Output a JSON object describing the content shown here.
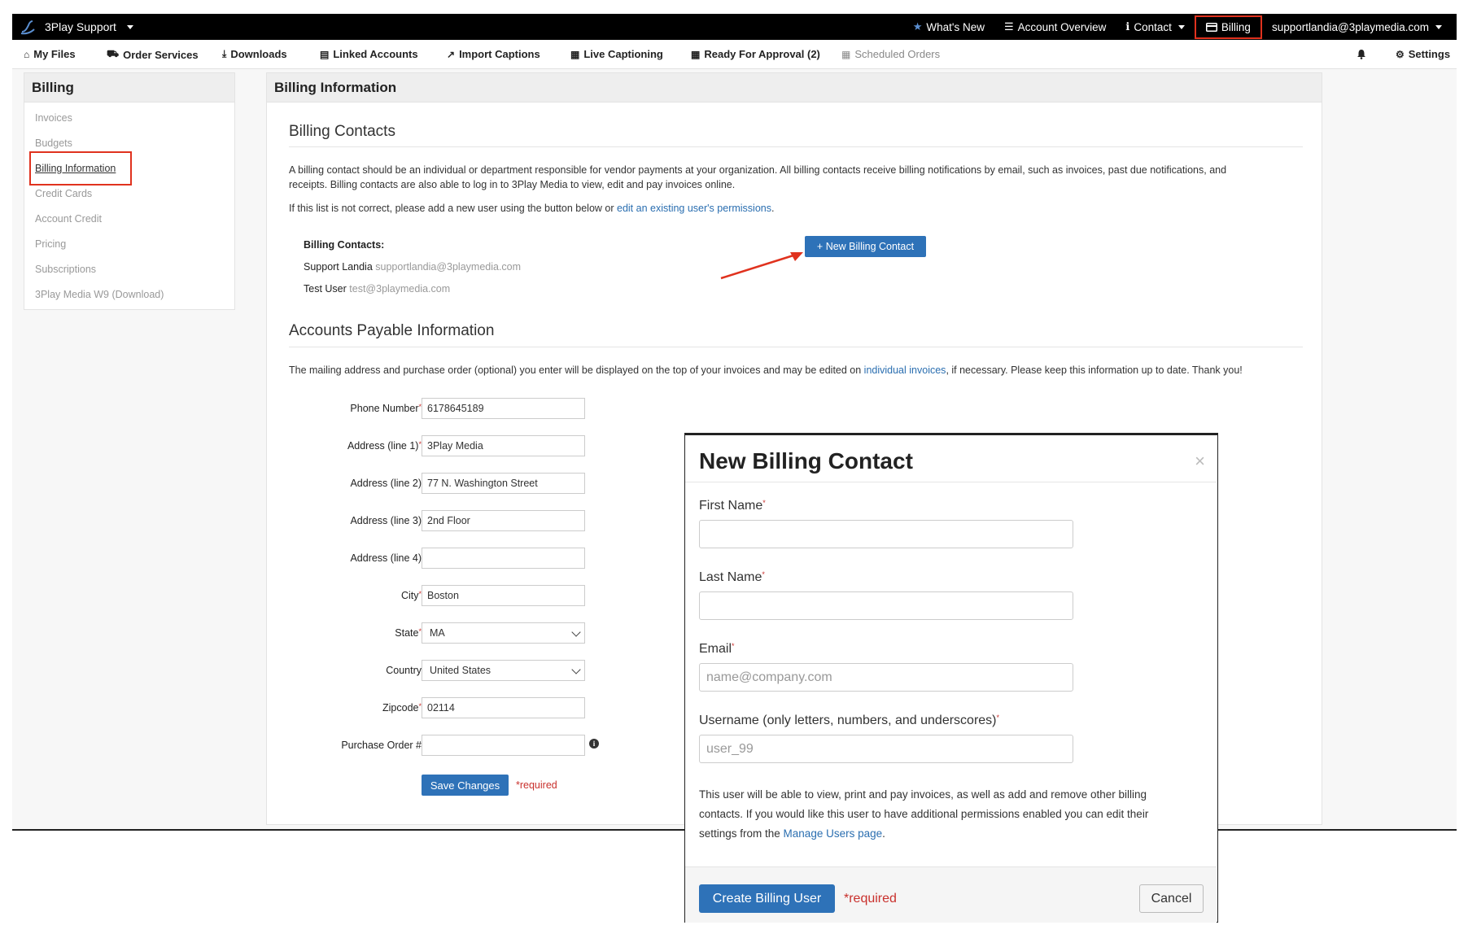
{
  "topbar": {
    "brand": "3Play Support",
    "items": [
      {
        "icon": "star-icon",
        "label": "What's New"
      },
      {
        "icon": "list-icon",
        "label": "Account Overview"
      },
      {
        "icon": "info-circle-icon",
        "label": "Contact"
      },
      {
        "icon": "credit-card-icon",
        "label": "Billing"
      },
      {
        "label": "supportlandia@3playmedia.com"
      }
    ]
  },
  "nav": {
    "items": [
      {
        "icon": "home-icon",
        "label": "My Files"
      },
      {
        "icon": "cart-icon",
        "label": "Order Services"
      },
      {
        "icon": "download-icon",
        "label": "Downloads"
      },
      {
        "icon": "id-card-icon",
        "label": "Linked Accounts"
      },
      {
        "icon": "external-link-icon",
        "label": "Import Captions"
      },
      {
        "icon": "calendar-icon",
        "label": "Live Captioning"
      },
      {
        "icon": "calendar-icon",
        "label": "Ready For Approval (2)"
      },
      {
        "icon": "calendar-icon",
        "label": "Scheduled Orders"
      }
    ],
    "settings": "Settings"
  },
  "sidebar": {
    "title": "Billing",
    "items": [
      "Invoices",
      "Budgets",
      "Billing Information",
      "Credit Cards",
      "Account Credit",
      "Pricing",
      "Subscriptions",
      "3Play Media W9 (Download)"
    ],
    "active_index": 2
  },
  "content": {
    "header": "Billing Information",
    "billing_contacts": {
      "title": "Billing Contacts",
      "description_1": "A billing contact should be an individual or department responsible for vendor payments at your organization. All billing contacts receive billing notifications by email, such as invoices, past due notifications, and",
      "description_2": "receipts. Billing contacts are also able to log in to 3Play Media to view, edit and pay invoices online.",
      "instruction_prefix": "If this list is not correct, please add a new user using the button below or ",
      "instruction_link": "edit an existing user's permissions",
      "instruction_suffix": ".",
      "list_label": "Billing Contacts:",
      "contacts": [
        {
          "name": "Support Landia",
          "email": "supportlandia@3playmedia.com"
        },
        {
          "name": "Test User",
          "email": "test@3playmedia.com"
        }
      ],
      "new_button": "+ New Billing Contact"
    },
    "accounts_payable": {
      "title": "Accounts Payable Information",
      "description_prefix": "The mailing address and purchase order (optional) you enter will be displayed on the top of your invoices and may be edited on ",
      "description_link": "individual invoices",
      "description_suffix": ", if necessary. Please keep this information up to date. Thank you!",
      "fields": [
        {
          "label": "Phone Number",
          "required": true,
          "value": "6178645189"
        },
        {
          "label": "Address (line 1)",
          "required": true,
          "value": "3Play Media"
        },
        {
          "label": "Address (line 2)",
          "required": false,
          "value": "77 N. Washington Street"
        },
        {
          "label": "Address (line 3)",
          "required": false,
          "value": "2nd Floor"
        },
        {
          "label": "Address (line 4)",
          "required": false,
          "value": ""
        },
        {
          "label": "City",
          "required": true,
          "value": "Boston"
        },
        {
          "label": "State",
          "required": true,
          "value": "MA",
          "type": "select"
        },
        {
          "label": "Country",
          "required": false,
          "value": "United States",
          "type": "select"
        },
        {
          "label": "Zipcode",
          "required": true,
          "value": "02114"
        },
        {
          "label": "Purchase Order #",
          "required": false,
          "value": ""
        }
      ],
      "save_button": "Save Changes",
      "required_note": "*required"
    }
  },
  "modal": {
    "title": "New Billing Contact",
    "close": "×",
    "fields": [
      {
        "label": "First Name",
        "placeholder": ""
      },
      {
        "label": "Last Name",
        "placeholder": ""
      },
      {
        "label": "Email",
        "placeholder": "name@company.com"
      },
      {
        "label": "Username (only letters, numbers, and underscores)",
        "placeholder": "user_99"
      }
    ],
    "info_line_1": "This user will be able to view, print and pay invoices, as well as add and remove other billing",
    "info_line_2": "contacts. If you would like this user to have additional permissions enabled you can edit their",
    "info_line_3_prefix": "settings from the ",
    "info_link": "Manage Users page",
    "info_line_3_suffix": ".",
    "create_button": "Create Billing User",
    "required_note": "*required",
    "cancel_button": "Cancel"
  },
  "colors": {
    "primary": "#2e72b8",
    "highlight": "#e0321e",
    "required": "#c9302c",
    "link": "#2a6eb0"
  }
}
